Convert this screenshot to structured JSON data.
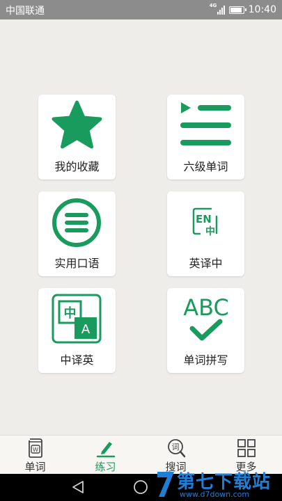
{
  "status_bar": {
    "carrier": "中国联通",
    "network": "4G",
    "time": "10:40"
  },
  "tiles": [
    {
      "id": "favorites",
      "label": "我的收藏",
      "icon": "star-icon"
    },
    {
      "id": "cet6",
      "label": "六级单词",
      "icon": "list-icon"
    },
    {
      "id": "spoken",
      "label": "实用口语",
      "icon": "circle-menu-icon"
    },
    {
      "id": "en-zh",
      "label": "英译中",
      "icon": "en-zh-icon",
      "icon_text": [
        "EN",
        "中"
      ]
    },
    {
      "id": "zh-en",
      "label": "中译英",
      "icon": "zh-en-icon",
      "icon_text": [
        "中",
        "A"
      ]
    },
    {
      "id": "spelling",
      "label": "单词拼写",
      "icon": "abc-check-icon",
      "icon_text": [
        "ABC"
      ]
    }
  ],
  "tabs": [
    {
      "label": "单词",
      "icon": "word-book-icon",
      "icon_text": "W",
      "active": false
    },
    {
      "label": "练习",
      "icon": "pen-icon",
      "active": true
    },
    {
      "label": "搜词",
      "icon": "search-word-icon",
      "icon_text": "词",
      "active": false
    },
    {
      "label": "更多",
      "icon": "grid-icon",
      "active": false
    }
  ],
  "watermark": {
    "title": "第七下载站",
    "url": "www.d7down.com"
  },
  "colors": {
    "accent": "#1a9b5e",
    "background": "#efedea",
    "status_bar": "#8c8c8c",
    "watermark": "#1f7fd6"
  }
}
